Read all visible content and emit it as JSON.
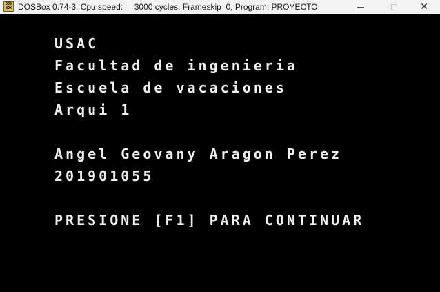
{
  "window": {
    "title": "DOSBox 0.74-3, Cpu speed:     3000 cycles, Frameskip  0, Program: PROYECTO",
    "icon_top": "DOS",
    "icon_bottom": "BOX",
    "icon_name": "dosbox-icon"
  },
  "screen": {
    "lines": [
      "USAC",
      "Facultad de ingenieria",
      "Escuela de vacaciones",
      "Arqui 1",
      "Angel Geovany Aragon Perez",
      "201901055",
      "PRESIONE [F1] PARA CONTINUAR"
    ],
    "text_color": "#f0f0f0",
    "background_color": "#000000"
  }
}
